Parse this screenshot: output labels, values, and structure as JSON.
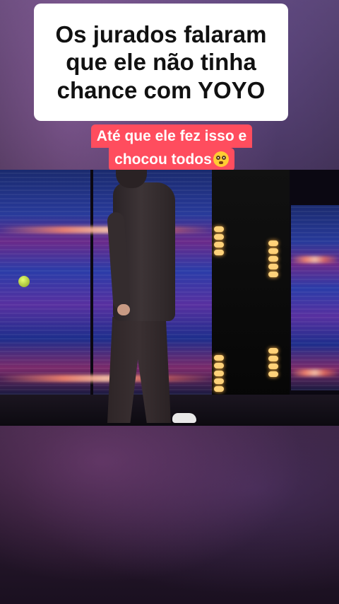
{
  "overlay": {
    "title_text": "Os jurados falaram\nque ele não tinha\nchance com YOYO",
    "subtitle_line1": "Até que ele fez isso e",
    "subtitle_line2": "chocou todos",
    "subtitle_emoji": "flushed-face-emoji"
  },
  "colors": {
    "title_bg": "#ffffff",
    "title_text": "#111111",
    "subtitle_bg": "#ff4d5e",
    "subtitle_text": "#ffffff"
  }
}
